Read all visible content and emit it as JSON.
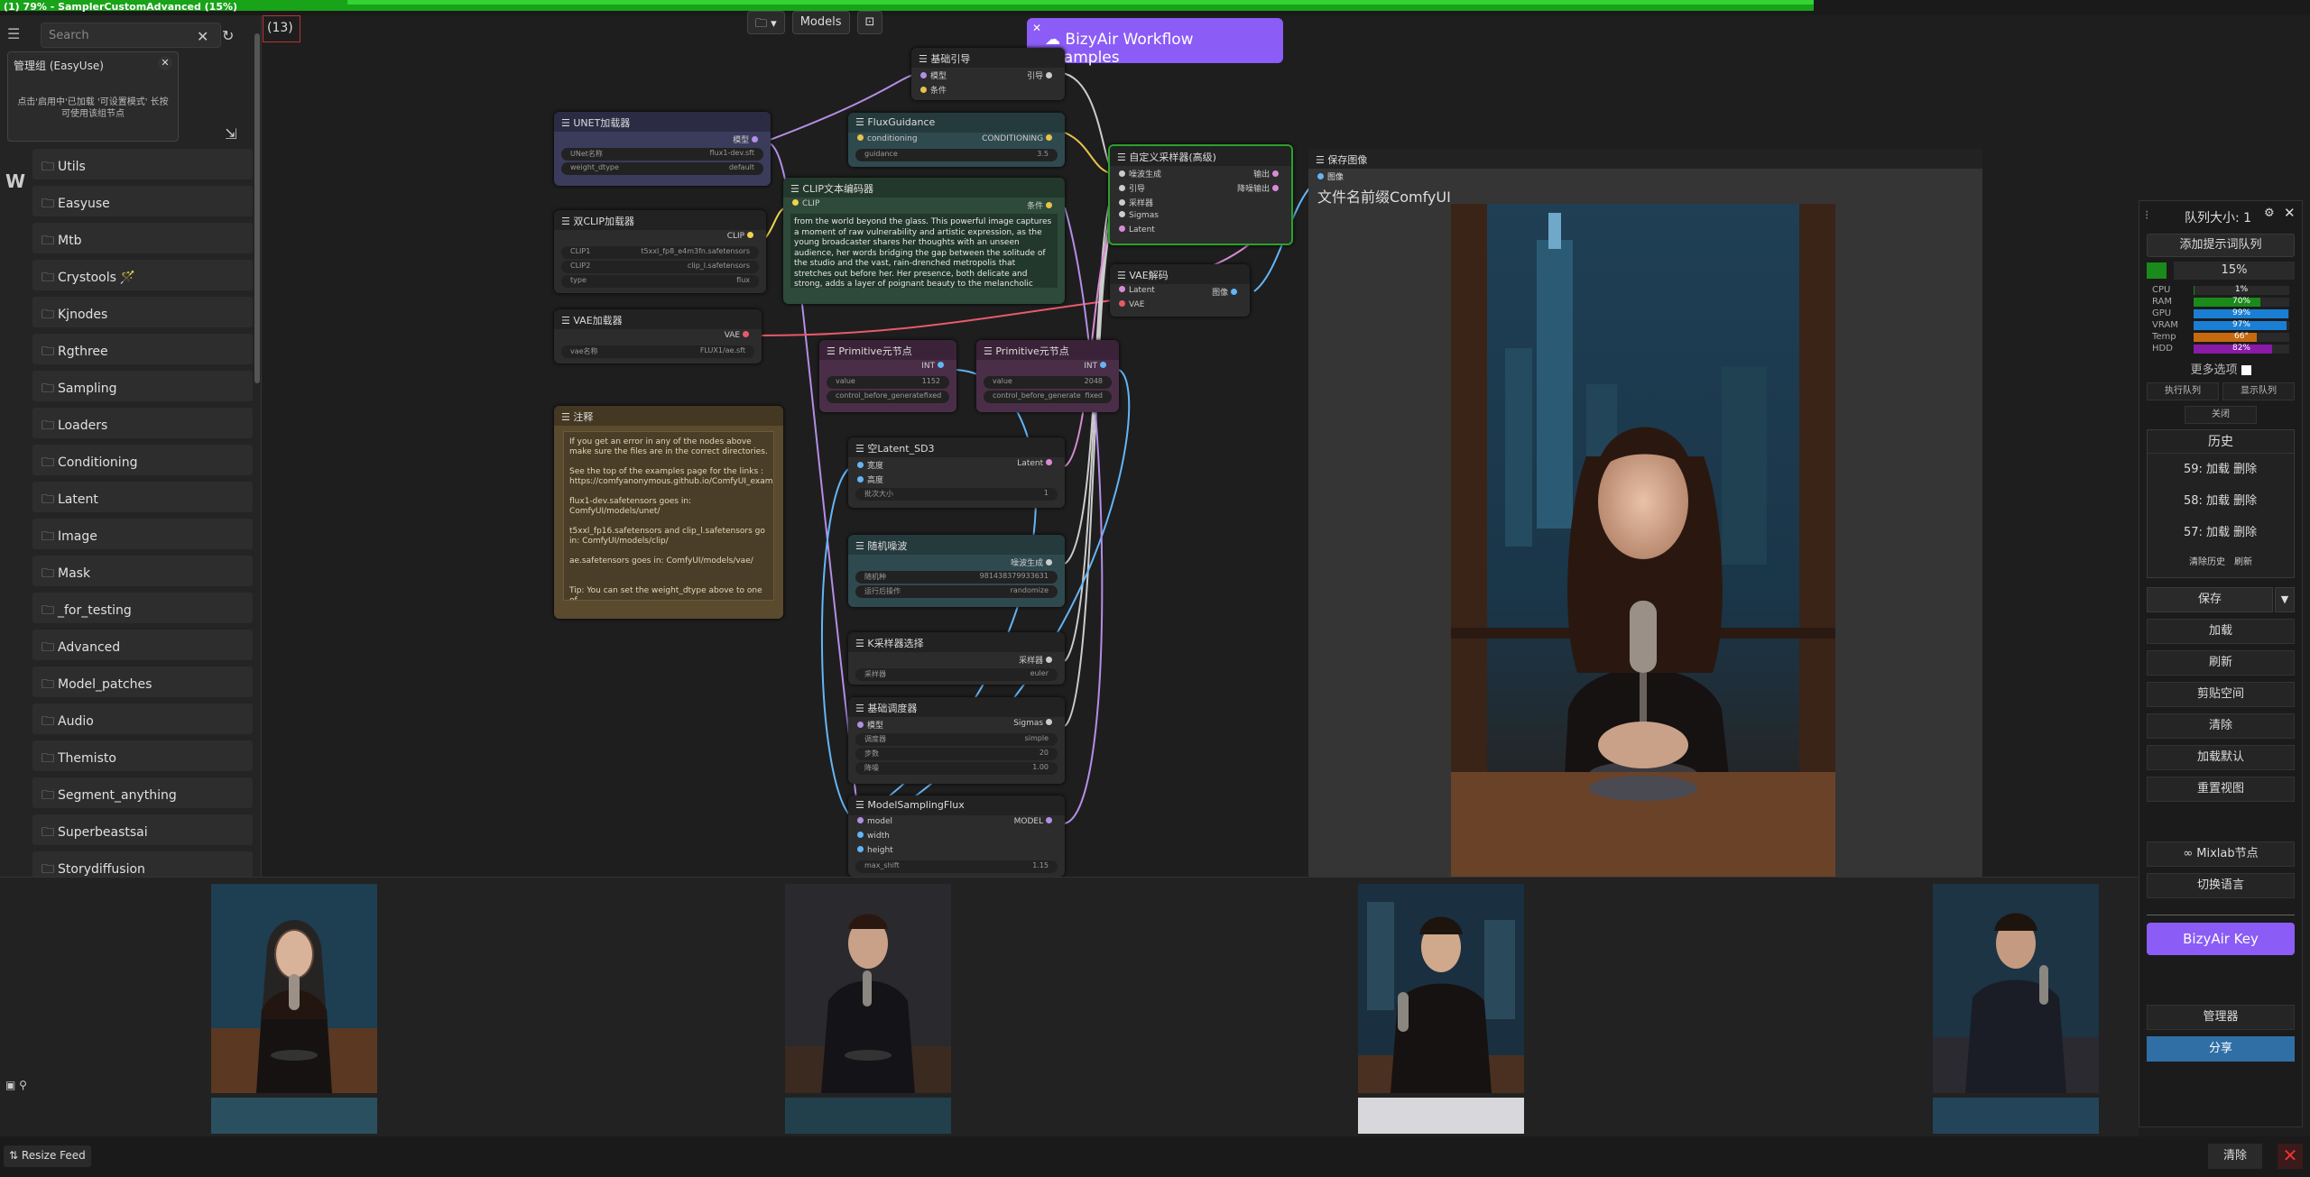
{
  "window": {
    "title": "(1) 79% - SamplerCustomAdvanced (15%)"
  },
  "sidebar": {
    "search_placeholder": "Search",
    "easyuse": {
      "title": "管理组 (EasyUse)",
      "tip": "点击'启用中'已加载 '可设置模式' 长按可使用该组节点"
    },
    "folders": [
      "Utils",
      "Easyuse",
      "Mtb",
      "Crystools",
      "Kjnodes",
      "Rgthree",
      "Sampling",
      "Loaders",
      "Conditioning",
      "Latent",
      "Image",
      "Mask",
      "_for_testing",
      "Advanced",
      "Model_patches",
      "Audio",
      "Themisto",
      "Segment_anything",
      "Superbeastsai",
      "Storydiffusion"
    ],
    "crystools_emoji": "🪄"
  },
  "canvas": {
    "count": "(13)",
    "toolbar": {
      "folder": "▾",
      "models": "Models"
    },
    "bizy_banner": "BizyAir Workflow Examples"
  },
  "nodes": {
    "unet": {
      "title": "UNET加载器",
      "out": "模型",
      "w1l": "UNet名称",
      "w1v": "flux1-dev.sft",
      "w2l": "weight_dtype",
      "w2v": "default"
    },
    "dualclip": {
      "title": "双CLIP加载器",
      "out": "CLIP",
      "w1l": "CLIP1",
      "w1v": "t5xxl_fp8_e4m3fn.safetensors",
      "w2l": "CLIP2",
      "w2v": "clip_l.safetensors",
      "w3l": "type",
      "w3v": "flux"
    },
    "vae": {
      "title": "VAE加载器",
      "out": "VAE",
      "w1l": "vae名称",
      "w1v": "FLUX1/ae.sft"
    },
    "note": {
      "title": "注释",
      "text": "If you get an error in any of the nodes above make sure the files are in the correct directories.\n\nSee the top of the examples page for the links : https://comfyanonymous.github.io/ComfyUI_examples/flux/\n\nflux1-dev.safetensors goes in: ComfyUI/models/unet/\n\nt5xxl_fp16.safetensors and clip_l.safetensors go in: ComfyUI/models/clip/\n\nae.safetensors goes in: ComfyUI/models/vae/\n\n\nTip: You can set the weight_dtype above to one of"
    },
    "guider": {
      "title": "基础引导",
      "in1": "模型",
      "in2": "条件",
      "out": "引导"
    },
    "fluxguidance": {
      "title": "FluxGuidance",
      "in": "conditioning",
      "out": "CONDITIONING",
      "wl": "guidance",
      "wv": "3.5"
    },
    "clipencode": {
      "title": "CLIP文本编码器",
      "in": "CLIP",
      "out": "条件",
      "text": "from the world beyond the glass. This powerful image captures a moment of raw vulnerability and artistic expression, as the young broadcaster shares her thoughts with an unseen audience, her words bridging the gap between the solitude of the studio and the vast, rain-drenched metropolis that stretches out before her. Her presence, both delicate and strong, adds a layer of poignant beauty to the melancholic scene, her voice a beacon in the stormy night."
    },
    "custom_sampler": {
      "title": "自定义采样器(高级)",
      "in": [
        "噪波生成",
        "引导",
        "采样器",
        "Sigmas",
        "Latent"
      ],
      "out1": "输出",
      "out2": "降噪输出"
    },
    "vaedecode": {
      "title": "VAE解码",
      "in1": "Latent",
      "in2": "VAE",
      "out": "图像"
    },
    "prim1": {
      "title": "Primitive元节点",
      "out": "INT",
      "w1l": "value",
      "w1v": "1152",
      "w2l": "control_before_generate",
      "w2v": "fixed"
    },
    "prim2": {
      "title": "Primitive元节点",
      "out": "INT",
      "w1l": "value",
      "w1v": "2048",
      "w2l": "control_before_generate",
      "w2v": "fixed"
    },
    "latent": {
      "title": "空Latent_SD3",
      "in1": "宽度",
      "in2": "高度",
      "out": "Latent",
      "wl": "批次大小",
      "wv": "1"
    },
    "noise": {
      "title": "随机噪波",
      "out": "噪波生成",
      "w1l": "随机种",
      "w1v": "981438379933631",
      "w2l": "运行后操作",
      "w2v": "randomize"
    },
    "ksampler_sel": {
      "title": "K采样器选择",
      "out": "采样器",
      "wl": "采样器",
      "wv": "euler"
    },
    "scheduler": {
      "title": "基础调度器",
      "in": "模型",
      "out": "Sigmas",
      "w1l": "调度器",
      "w1v": "simple",
      "w2l": "步数",
      "w2v": "20",
      "w3l": "降噪",
      "w3v": "1.00"
    },
    "msflux": {
      "title": "ModelSamplingFlux",
      "in1": "model",
      "in2": "width",
      "in3": "height",
      "out": "MODEL",
      "wl": "max_shift",
      "wv": "1.15"
    },
    "saveimage": {
      "title": "保存图像",
      "in": "图像",
      "wl": "文件名前缀",
      "wv": "ComfyUI"
    }
  },
  "queue": {
    "title": "队列大小: 1",
    "add_prompt": "添加提示词队列",
    "percent": "15%",
    "stats": [
      {
        "label": "CPU",
        "value": "1%",
        "fraction": 0.01,
        "color": "#1a8a1a"
      },
      {
        "label": "RAM",
        "value": "70%",
        "fraction": 0.7,
        "color": "#1a8a1a"
      },
      {
        "label": "GPU",
        "value": "99%",
        "fraction": 0.99,
        "color": "#1a7fd4"
      },
      {
        "label": "VRAM",
        "value": "97%",
        "fraction": 0.97,
        "color": "#1a7fd4"
      },
      {
        "label": "Temp",
        "value": "66°",
        "fraction": 0.66,
        "color": "#c66a10"
      },
      {
        "label": "HDD",
        "value": "82%",
        "fraction": 0.82,
        "color": "#8a1aa8"
      }
    ],
    "more_options": "更多选项",
    "exec_queue": "执行队列",
    "show_queue": "显示队列",
    "close": "关闭",
    "history_title": "历史",
    "history": [
      "59: 加载 删除",
      "58: 加载 删除",
      "57: 加载 删除"
    ],
    "clear_history": "清除历史",
    "refresh_small": "刷新",
    "save": "保存",
    "load": "加载",
    "refresh": "刷新",
    "clipspace": "剪贴空间",
    "clear": "清除",
    "load_default": "加载默认",
    "reset_view": "重置视图",
    "mixlab": "∞ Mixlab节点",
    "switch_lang": "切换语言",
    "bizyair_key": "BizyAir Key",
    "manager": "管理器",
    "share": "分享"
  },
  "bottom": {
    "resize_feed": "Resize Feed",
    "clear": "清除"
  }
}
